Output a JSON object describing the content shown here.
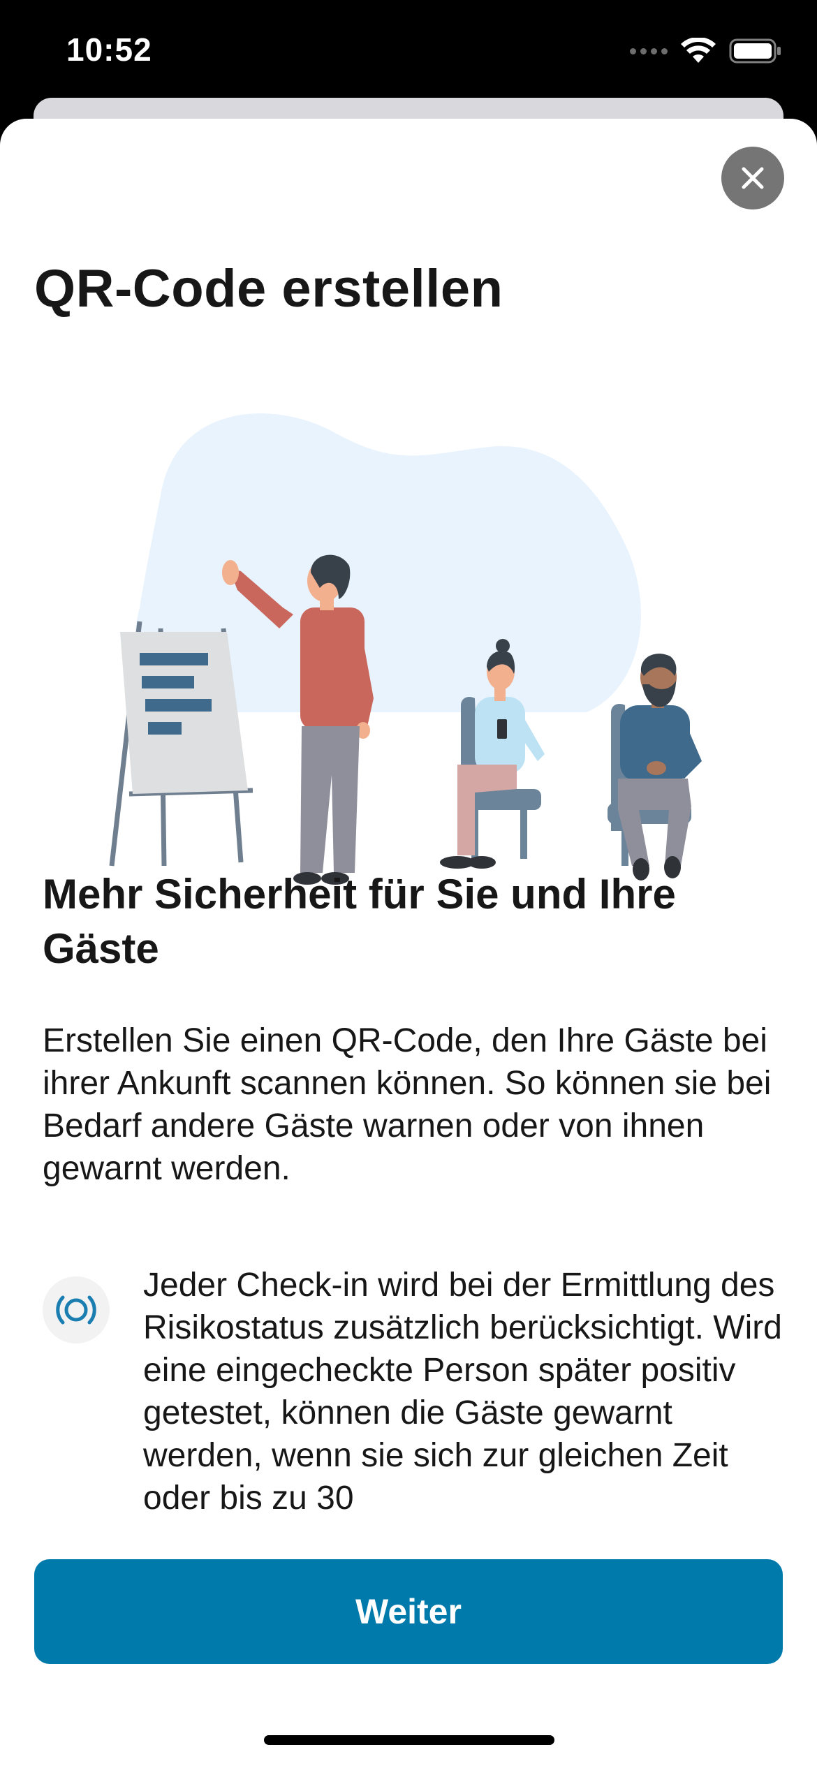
{
  "status_bar": {
    "time": "10:52"
  },
  "sheet": {
    "title": "QR-Code erstellen",
    "close_icon": "close-icon"
  },
  "illustration": {
    "description_icon": "presentation-illustration"
  },
  "content": {
    "heading": "Mehr Sicherheit für Sie und Ihre Gäste",
    "body": "Erstellen Sie einen QR-Code, den Ihre Gäste bei ihrer Ankunft scannen können. So können sie bei Bedarf andere Gäste warnen oder von ihnen gewarnt werden.",
    "info_icon": "exposure-tracing-icon",
    "info_text": "Jeder Check-in wird bei der Ermittlung des Risikostatus zusätzlich berücksichtigt. Wird eine eingecheckte Person später positiv getestet, können die Gäste gewarnt werden, wenn sie sich zur gleichen Zeit oder bis zu 30"
  },
  "footer": {
    "primary_label": "Weiter"
  },
  "colors": {
    "accent": "#007aab",
    "close_bg": "#757575",
    "text": "#171717",
    "illustration_bg": "#e8f3fd"
  }
}
